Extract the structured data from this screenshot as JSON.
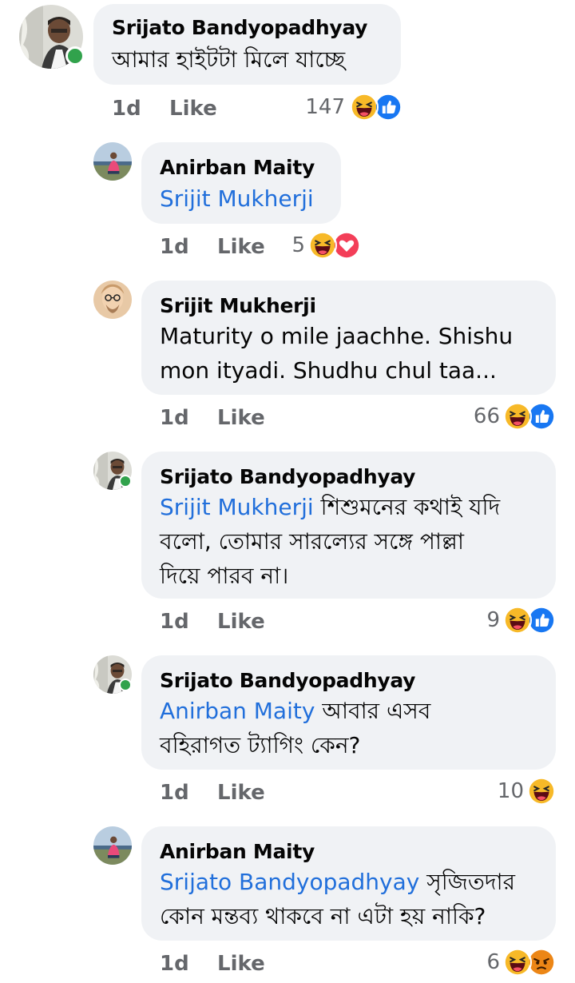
{
  "comments": [
    {
      "author": "Srijato Bandyopadhyay",
      "text": "আমার হাইটটা মিলে যাচ্ছে",
      "age": "1d",
      "like": "Like",
      "reaction_count": "147",
      "reactions": [
        "haha-icon",
        "like-icon"
      ],
      "online": true
    },
    {
      "author": "Anirban Maity",
      "mention": "Srijit Mukherji",
      "age": "1d",
      "like": "Like",
      "reaction_count": "5",
      "reactions": [
        "haha-icon",
        "love-icon"
      ]
    },
    {
      "author": "Srijit Mukherji",
      "lines": [
        "Maturity o mile jaachhe. Shishu",
        "mon ityadi. Shudhu chul taa..."
      ],
      "age": "1d",
      "like": "Like",
      "reaction_count": "66",
      "reactions": [
        "haha-icon",
        "like-icon"
      ]
    },
    {
      "author": "Srijato Bandyopadhyay",
      "mention": "Srijit Mukherji",
      "line1_rest": " শিশুমনের কথাই যদি",
      "lines": [
        "বলো, তোমার সারল্যের সঙ্গে পাল্লা",
        "দিয়ে পারব না।"
      ],
      "age": "1d",
      "like": "Like",
      "reaction_count": "9",
      "reactions": [
        "haha-icon",
        "like-icon"
      ],
      "online": true
    },
    {
      "author": "Srijato Bandyopadhyay",
      "mention": "Anirban Maity",
      "line1_rest": " আবার এসব",
      "lines": [
        "বহিরাগত ট্যাগিং কেন?"
      ],
      "age": "1d",
      "like": "Like",
      "reaction_count": "10",
      "reactions": [
        "haha-icon"
      ],
      "online": true
    },
    {
      "author": "Anirban Maity",
      "mention": "Srijato Bandyopadhyay",
      "line1_rest": " সৃজিতদার",
      "lines": [
        "কোন মন্তব্য থাকবে না এটা হয় নাকি?"
      ],
      "age": "1d",
      "like": "Like",
      "reaction_count": "6",
      "reactions": [
        "haha-icon",
        "angry-icon"
      ]
    }
  ],
  "colors": {
    "bubble": "#f0f2f5",
    "mention": "#216fdb",
    "meta": "#65676b",
    "online": "#31a24c",
    "like_blue": "#1877f2",
    "love_red": "#f33e58",
    "haha_yellow": "#f7b928",
    "angry_orange": "#e9710f"
  }
}
